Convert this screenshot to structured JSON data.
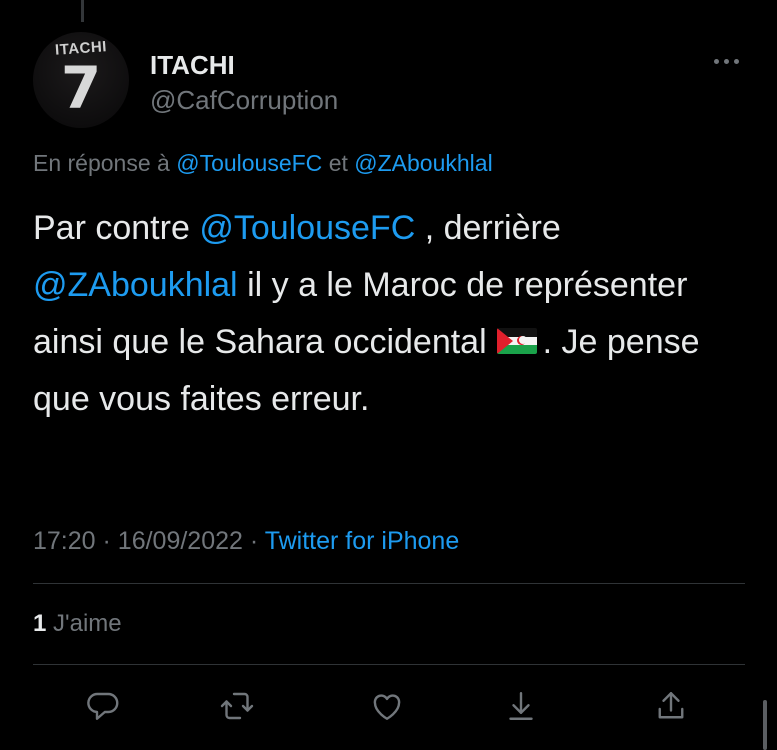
{
  "tweet": {
    "author": {
      "display_name": "ITACHI",
      "handle": "@CafCorruption",
      "avatar_jersey_name": "ITACHI",
      "avatar_jersey_number": "7"
    },
    "reply_to": {
      "prefix": "En réponse à",
      "mention_1": "@ToulouseFC",
      "joiner": "et",
      "mention_2": "@ZAboukhlal"
    },
    "text": {
      "part_1": "Par contre",
      "mention_1": "@ToulouseFC",
      "part_2": ", derrière",
      "mention_2": "@ZAboukhlal",
      "part_3": "il y a le Maroc de représenter ainsi que le Sahara occidental",
      "part_4": ". Je pense que vous faites erreur."
    },
    "time": "17:20",
    "separator": "·",
    "date": "16/09/2022",
    "source": "Twitter for iPhone",
    "likes_count": "1",
    "likes_label": "J'aime"
  },
  "actions": [
    "reply-icon",
    "retweet-icon",
    "like-icon",
    "bookmark-icon",
    "share-icon"
  ],
  "colors": {
    "background": "#000000",
    "text_primary": "#e7e9ea",
    "text_secondary": "#71767b",
    "accent": "#1d9bf0",
    "divider": "#2f3336"
  }
}
